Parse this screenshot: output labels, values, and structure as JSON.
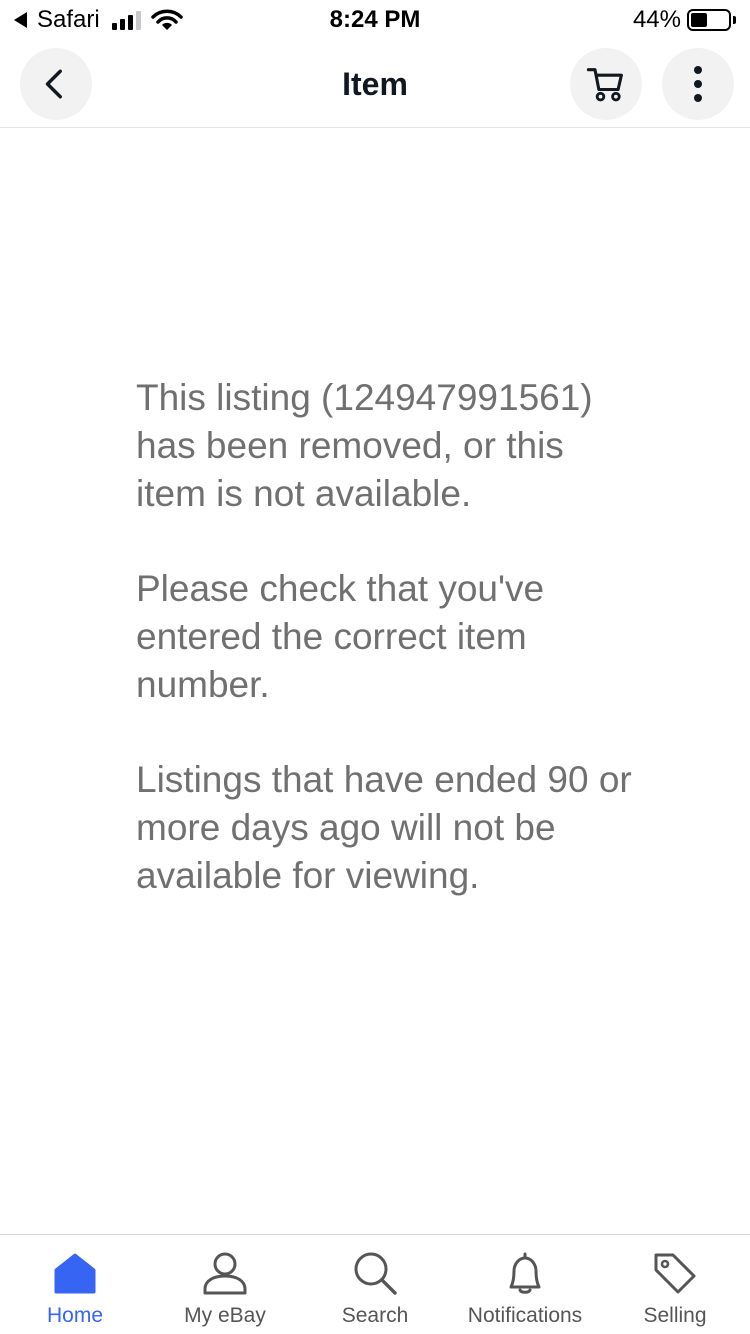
{
  "status_bar": {
    "app": "Safari",
    "time": "8:24 PM",
    "battery": "44%",
    "battery_level": 0.44
  },
  "header": {
    "title": "Item",
    "back_icon": "chevron-left-icon",
    "cart_icon": "cart-icon",
    "more_icon": "more-vertical-icon"
  },
  "message": {
    "p1": "This listing (124947991561) has been removed, or this item is not available.",
    "p2": "Please check that you've entered the correct item number.",
    "p3": "Listings that have ended 90 or more days ago will not be available for viewing."
  },
  "tabs": [
    {
      "label": "Home",
      "icon": "home-icon",
      "active": true
    },
    {
      "label": "My eBay",
      "icon": "person-icon",
      "active": false
    },
    {
      "label": "Search",
      "icon": "search-icon",
      "active": false
    },
    {
      "label": "Notifications",
      "icon": "bell-icon",
      "active": false
    },
    {
      "label": "Selling",
      "icon": "tag-icon",
      "active": false
    }
  ],
  "colors": {
    "accent": "#3665f3",
    "text": "#111820",
    "muted": "#707070"
  }
}
